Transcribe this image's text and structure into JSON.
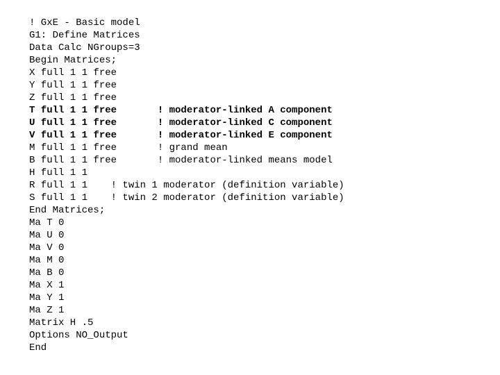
{
  "lines": [
    {
      "bold": false,
      "text": "! GxE - Basic model"
    },
    {
      "bold": false,
      "text": "G1: Define Matrices"
    },
    {
      "bold": false,
      "text": "Data Calc NGroups=3"
    },
    {
      "bold": false,
      "text": "Begin Matrices;"
    },
    {
      "bold": false,
      "text": "X full 1 1 free"
    },
    {
      "bold": false,
      "text": "Y full 1 1 free"
    },
    {
      "bold": false,
      "text": "Z full 1 1 free"
    },
    {
      "bold": true,
      "text": "T full 1 1 free       ! moderator-linked A component"
    },
    {
      "bold": true,
      "text": "U full 1 1 free       ! moderator-linked C component"
    },
    {
      "bold": true,
      "text": "V full 1 1 free       ! moderator-linked E component"
    },
    {
      "bold": false,
      "text": "M full 1 1 free       ! grand mean"
    },
    {
      "bold": false,
      "text": "B full 1 1 free       ! moderator-linked means model"
    },
    {
      "bold": false,
      "text": "H full 1 1"
    },
    {
      "bold": false,
      "text": "R full 1 1    ! twin 1 moderator (definition variable)"
    },
    {
      "bold": false,
      "text": "S full 1 1    ! twin 2 moderator (definition variable)"
    },
    {
      "bold": false,
      "text": "End Matrices;"
    },
    {
      "bold": false,
      "text": "Ma T 0"
    },
    {
      "bold": false,
      "text": "Ma U 0"
    },
    {
      "bold": false,
      "text": "Ma V 0"
    },
    {
      "bold": false,
      "text": "Ma M 0"
    },
    {
      "bold": false,
      "text": "Ma B 0"
    },
    {
      "bold": false,
      "text": "Ma X 1"
    },
    {
      "bold": false,
      "text": "Ma Y 1"
    },
    {
      "bold": false,
      "text": "Ma Z 1"
    },
    {
      "bold": false,
      "text": "Matrix H .5"
    },
    {
      "bold": false,
      "text": "Options NO_Output"
    },
    {
      "bold": false,
      "text": "End"
    }
  ]
}
